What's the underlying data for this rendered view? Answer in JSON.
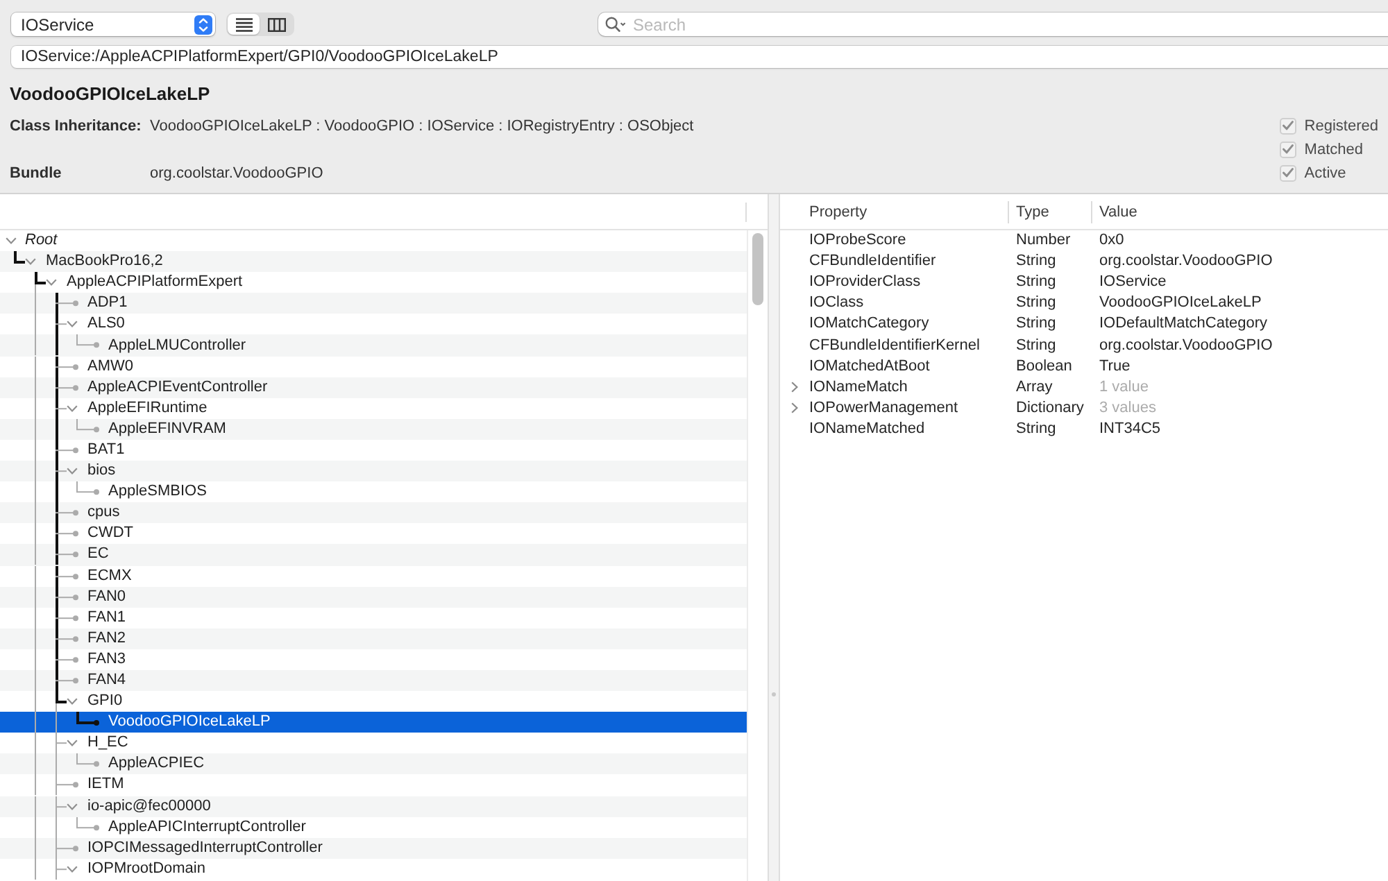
{
  "toolbar": {
    "plane_popup": {
      "value": "IOService"
    },
    "view_buttons": [
      {
        "selected": true
      },
      {
        "selected": false
      }
    ],
    "search": {
      "placeholder": "Search"
    }
  },
  "path_field": {
    "value": "IOService:/AppleACPIPlatformExpert/GPI0/VoodooGPIOIceLakeLP"
  },
  "details": {
    "title": "VoodooGPIOIceLakeLP",
    "fields": [
      {
        "label": "Class Inheritance:",
        "value": "VoodooGPIOIceLakeLP : VoodooGPIO : IOService : IORegistryEntry : OSObject"
      },
      {
        "label": "Bundle",
        "value": "org.coolstar.VoodooGPIO"
      }
    ],
    "flags": [
      {
        "label": "Registered",
        "checked": true,
        "disabled": true
      },
      {
        "label": "Matched",
        "checked": true,
        "disabled": true
      },
      {
        "label": "Active",
        "checked": true,
        "disabled": true
      }
    ]
  },
  "tree": [
    {
      "name": "Root",
      "expanded": true,
      "selected": false,
      "more_below": false,
      "children": [
        {
          "name": "MacBookPro16,2",
          "expanded": true,
          "selected": false,
          "more_below": true,
          "children": [
            {
              "name": "AppleACPIPlatformExpert",
              "expanded": true,
              "selected": false,
              "more_below": true,
              "children": [
                {
                  "name": "ADP1",
                  "expanded": false,
                  "selected": false
                },
                {
                  "name": "ALS0",
                  "expanded": true,
                  "selected": false,
                  "more_below": false,
                  "children": [
                    {
                      "name": "AppleLMUController",
                      "expanded": false,
                      "selected": false
                    }
                  ]
                },
                {
                  "name": "AMW0",
                  "expanded": false,
                  "selected": false
                },
                {
                  "name": "AppleACPIEventController",
                  "expanded": false,
                  "selected": false
                },
                {
                  "name": "AppleEFIRuntime",
                  "expanded": true,
                  "selected": false,
                  "more_below": false,
                  "children": [
                    {
                      "name": "AppleEFINVRAM",
                      "expanded": false,
                      "selected": false
                    }
                  ]
                },
                {
                  "name": "BAT1",
                  "expanded": false,
                  "selected": false
                },
                {
                  "name": "bios",
                  "expanded": true,
                  "selected": false,
                  "more_below": false,
                  "children": [
                    {
                      "name": "AppleSMBIOS",
                      "expanded": false,
                      "selected": false
                    }
                  ]
                },
                {
                  "name": "cpus",
                  "expanded": false,
                  "selected": false
                },
                {
                  "name": "CWDT",
                  "expanded": false,
                  "selected": false
                },
                {
                  "name": "EC",
                  "expanded": false,
                  "selected": false
                },
                {
                  "name": "ECMX",
                  "expanded": false,
                  "selected": false
                },
                {
                  "name": "FAN0",
                  "expanded": false,
                  "selected": false
                },
                {
                  "name": "FAN1",
                  "expanded": false,
                  "selected": false
                },
                {
                  "name": "FAN2",
                  "expanded": false,
                  "selected": false
                },
                {
                  "name": "FAN3",
                  "expanded": false,
                  "selected": false
                },
                {
                  "name": "FAN4",
                  "expanded": false,
                  "selected": false
                },
                {
                  "name": "GPI0",
                  "expanded": true,
                  "selected": false,
                  "more_below": false,
                  "children": [
                    {
                      "name": "VoodooGPIOIceLakeLP",
                      "expanded": false,
                      "selected": true
                    }
                  ]
                },
                {
                  "name": "H_EC",
                  "expanded": true,
                  "selected": false,
                  "more_below": false,
                  "children": [
                    {
                      "name": "AppleACPIEC",
                      "expanded": false,
                      "selected": false
                    }
                  ]
                },
                {
                  "name": "IETM",
                  "expanded": false,
                  "selected": false
                },
                {
                  "name": "io-apic@fec00000",
                  "expanded": true,
                  "selected": false,
                  "more_below": false,
                  "children": [
                    {
                      "name": "AppleAPICInterruptController",
                      "expanded": false,
                      "selected": false
                    }
                  ]
                },
                {
                  "name": "IOPCIMessagedInterruptController",
                  "expanded": false,
                  "selected": false
                },
                {
                  "name": "IOPMrootDomain",
                  "expanded": true,
                  "selected": false
                }
              ]
            }
          ]
        }
      ]
    }
  ],
  "properties": {
    "columns": [
      "Property",
      "Type",
      "Value"
    ],
    "rows": [
      {
        "kind": "value",
        "property": "IOProbeScore",
        "type": "Number",
        "value": "0x0"
      },
      {
        "kind": "value",
        "property": "CFBundleIdentifier",
        "type": "String",
        "value": "org.coolstar.VoodooGPIO"
      },
      {
        "kind": "value",
        "property": "IOProviderClass",
        "type": "String",
        "value": "IOService"
      },
      {
        "kind": "value",
        "property": "IOClass",
        "type": "String",
        "value": "VoodooGPIOIceLakeLP"
      },
      {
        "kind": "value",
        "property": "IOMatchCategory",
        "type": "String",
        "value": "IODefaultMatchCategory"
      },
      {
        "kind": "value",
        "property": "CFBundleIdentifierKernel",
        "type": "String",
        "value": "org.coolstar.VoodooGPIO"
      },
      {
        "kind": "value",
        "property": "IOMatchedAtBoot",
        "type": "Boolean",
        "value": "True"
      },
      {
        "kind": "collection",
        "property": "IONameMatch",
        "type": "Array",
        "value": "1 value"
      },
      {
        "kind": "collection",
        "property": "IOPowerManagement",
        "type": "Dictionary",
        "value": "3 values"
      },
      {
        "kind": "value",
        "property": "IONameMatched",
        "type": "String",
        "value": "INT34C5"
      }
    ]
  }
}
